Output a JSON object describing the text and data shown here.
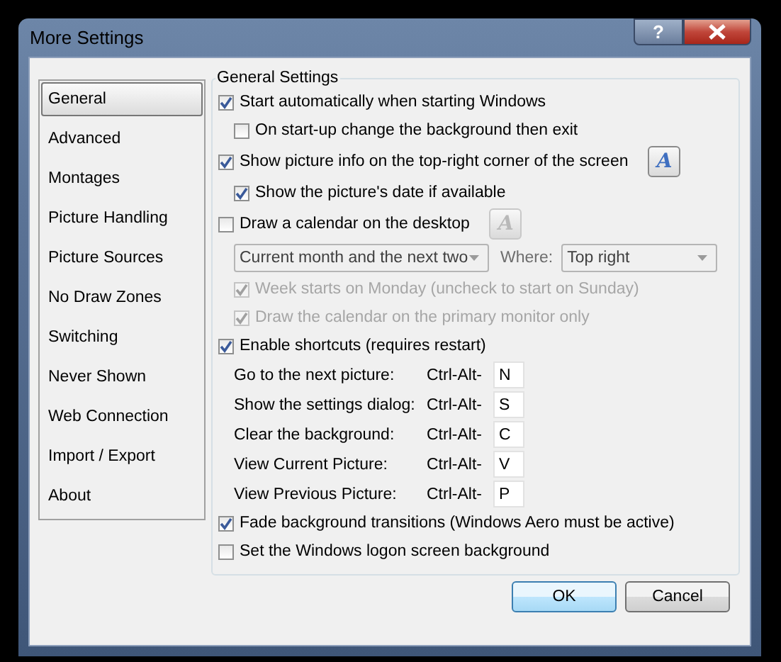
{
  "window": {
    "title": "More Settings",
    "help_button": "?"
  },
  "sidebar": {
    "items": [
      {
        "label": "General",
        "selected": true
      },
      {
        "label": "Advanced",
        "selected": false
      },
      {
        "label": "Montages",
        "selected": false
      },
      {
        "label": "Picture Handling",
        "selected": false
      },
      {
        "label": "Picture Sources",
        "selected": false
      },
      {
        "label": "No Draw Zones",
        "selected": false
      },
      {
        "label": "Switching",
        "selected": false
      },
      {
        "label": "Never Shown",
        "selected": false
      },
      {
        "label": "Web Connection",
        "selected": false
      },
      {
        "label": "Import / Export",
        "selected": false
      },
      {
        "label": "About",
        "selected": false
      }
    ]
  },
  "settings": {
    "title": "General Settings",
    "rows": [
      {
        "kind": "checkbox",
        "label": "Start automatically when starting Windows",
        "checked": true,
        "disabled": false,
        "children": [
          {
            "kind": "checkbox",
            "label": "On start-up change the background then exit",
            "checked": false,
            "disabled": false
          }
        ]
      },
      {
        "kind": "checkbox",
        "label": "Show picture info on the top-right corner of the screen",
        "checked": true,
        "disabled": false,
        "font_button": {
          "label": "A",
          "disabled": false
        },
        "children": [
          {
            "kind": "checkbox",
            "label": "Show the picture's date if available",
            "checked": true,
            "disabled": false
          }
        ]
      },
      {
        "kind": "checkbox",
        "label": "Draw a calendar on the desktop",
        "checked": false,
        "disabled": false,
        "font_button": {
          "label": "A",
          "disabled": true
        },
        "children": [
          {
            "kind": "dropdowns",
            "value": "Current month and the next two",
            "where_label": "Where:",
            "where_value": "Top right"
          },
          {
            "kind": "checkbox",
            "label": "Week starts on Monday (uncheck to start on Sunday)",
            "checked": true,
            "disabled": true
          },
          {
            "kind": "checkbox",
            "label": "Draw the calendar on the primary monitor only",
            "checked": true,
            "disabled": true
          }
        ]
      },
      {
        "kind": "checkbox",
        "label": "Enable shortcuts (requires restart)",
        "checked": true,
        "disabled": false,
        "children": [
          {
            "kind": "shortcut",
            "label": "Go to the next picture:",
            "prefix": "Ctrl-Alt-",
            "key": "N"
          },
          {
            "kind": "shortcut",
            "label": "Show the settings dialog:",
            "prefix": "Ctrl-Alt-",
            "key": "S"
          },
          {
            "kind": "shortcut",
            "label": "Clear the background:",
            "prefix": "Ctrl-Alt-",
            "key": "C"
          },
          {
            "kind": "shortcut",
            "label": "View Current Picture:",
            "prefix": "Ctrl-Alt-",
            "key": "V"
          },
          {
            "kind": "shortcut",
            "label": "View Previous Picture:",
            "prefix": "Ctrl-Alt-",
            "key": "P"
          }
        ]
      },
      {
        "kind": "checkbox",
        "label": "Fade background transitions (Windows Aero must be active)",
        "checked": true,
        "disabled": false
      },
      {
        "kind": "checkbox",
        "label": "Set the Windows logon screen background",
        "checked": false,
        "disabled": false
      }
    ]
  },
  "buttons": [
    {
      "label": "OK",
      "default": true
    },
    {
      "label": "Cancel",
      "default": false
    }
  ]
}
